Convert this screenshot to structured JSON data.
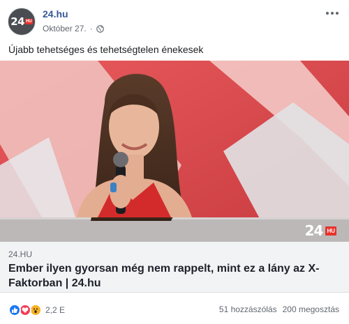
{
  "header": {
    "avatar_text": "24",
    "avatar_badge": "HU",
    "page_name": "24.hu",
    "date": "Október 27.",
    "privacy_icon": "globe-icon",
    "more_icon": "more-options-icon"
  },
  "post": {
    "text": "Újabb tehetséges és tehetségtelen énekesek"
  },
  "link_preview": {
    "watermark_text": "24",
    "watermark_badge": "HU",
    "domain": "24.HU",
    "title": "Ember ilyen gyorsan még nem rappelt, mint ez a lány az X-Faktorban | 24.hu"
  },
  "footer": {
    "reaction_icons": [
      "like-icon",
      "love-icon",
      "wow-icon"
    ],
    "reaction_count": "2,2 E",
    "comments": "51 hozzászólás",
    "shares": "200 megosztás"
  },
  "colors": {
    "page_name": "#385898",
    "brand_red": "#e8312b",
    "like_blue": "#1877f2",
    "love_red": "#f33e58",
    "wow_yellow": "#f7b125"
  }
}
